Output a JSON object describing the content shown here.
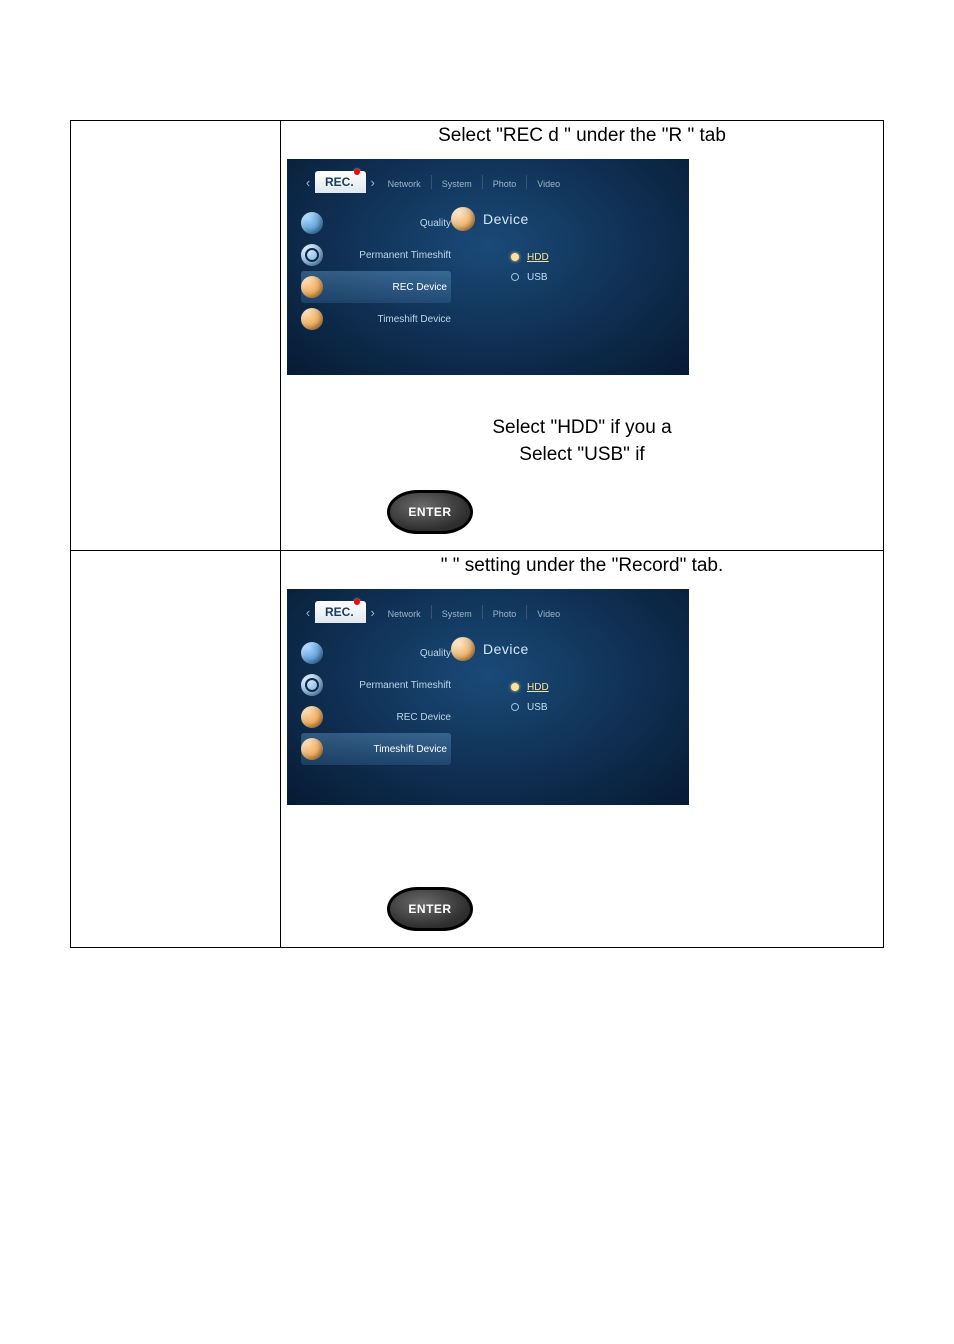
{
  "rows": [
    {
      "heading": "Select \"REC d           \" under the \"R                 \" tab",
      "screenshot": {
        "active_tab": "REC.",
        "inactive_tabs": [
          "Network",
          "System",
          "Photo",
          "Video"
        ],
        "left_menu": [
          {
            "label": "Quality",
            "icon": "quality",
            "highlight": false
          },
          {
            "label": "Permanent Timeshift",
            "icon": "timeshift",
            "highlight": false
          },
          {
            "label": "REC Device",
            "icon": "rec",
            "highlight": true
          },
          {
            "label": "Timeshift Device",
            "icon": "tsdev",
            "highlight": false
          }
        ],
        "panel_title": "Device",
        "options": [
          {
            "label": "HDD",
            "selected": true
          },
          {
            "label": "USB",
            "selected": false
          }
        ],
        "highlight_index": 2
      },
      "instr_lines": [
        "Select \"HDD\" if you a",
        "Select \"USB\" if"
      ],
      "enter_label": "ENTER"
    },
    {
      "heading": "\"                       \" setting under the \"Record\" tab.",
      "screenshot": {
        "active_tab": "REC.",
        "inactive_tabs": [
          "Network",
          "System",
          "Photo",
          "Video"
        ],
        "left_menu": [
          {
            "label": "Quality",
            "icon": "quality",
            "highlight": false
          },
          {
            "label": "Permanent Timeshift",
            "icon": "timeshift",
            "highlight": false
          },
          {
            "label": "REC Device",
            "icon": "rec",
            "highlight": false
          },
          {
            "label": "Timeshift Device",
            "icon": "tsdev",
            "highlight": true
          }
        ],
        "panel_title": "Device",
        "options": [
          {
            "label": "HDD",
            "selected": true
          },
          {
            "label": "USB",
            "selected": false
          }
        ],
        "highlight_index": 3
      },
      "instr_lines": [],
      "enter_label": "ENTER"
    }
  ]
}
